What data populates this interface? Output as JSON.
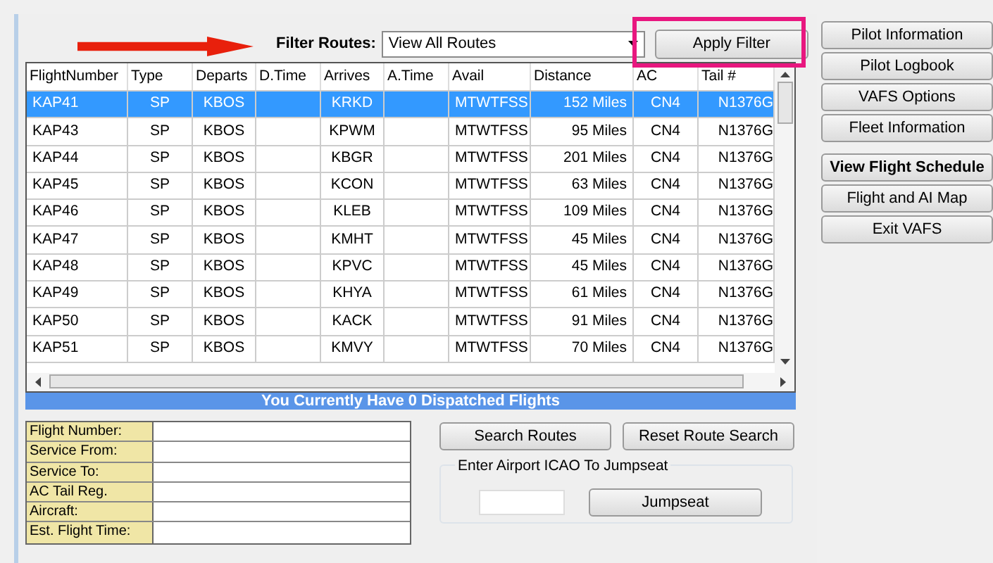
{
  "filter": {
    "label": "Filter Routes:",
    "value": "View All Routes",
    "apply": "Apply Filter"
  },
  "table": {
    "columns": [
      "FlightNumber",
      "Type",
      "Departs",
      "D.Time",
      "Arrives",
      "A.Time",
      "Avail",
      "Distance",
      "AC",
      "Tail #"
    ],
    "rows": [
      {
        "selected": true,
        "cells": [
          "KAP41",
          "SP",
          "KBOS",
          "",
          "KRKD",
          "",
          "MTWTFSS",
          "152 Miles",
          "CN4",
          "N1376G"
        ]
      },
      {
        "selected": false,
        "cells": [
          "KAP43",
          "SP",
          "KBOS",
          "",
          "KPWM",
          "",
          "MTWTFSS",
          "95 Miles",
          "CN4",
          "N1376G"
        ]
      },
      {
        "selected": false,
        "cells": [
          "KAP44",
          "SP",
          "KBOS",
          "",
          "KBGR",
          "",
          "MTWTFSS",
          "201 Miles",
          "CN4",
          "N1376G"
        ]
      },
      {
        "selected": false,
        "cells": [
          "KAP45",
          "SP",
          "KBOS",
          "",
          "KCON",
          "",
          "MTWTFSS",
          "63 Miles",
          "CN4",
          "N1376G"
        ]
      },
      {
        "selected": false,
        "cells": [
          "KAP46",
          "SP",
          "KBOS",
          "",
          "KLEB",
          "",
          "MTWTFSS",
          "109 Miles",
          "CN4",
          "N1376G"
        ]
      },
      {
        "selected": false,
        "cells": [
          "KAP47",
          "SP",
          "KBOS",
          "",
          "KMHT",
          "",
          "MTWTFSS",
          "45 Miles",
          "CN4",
          "N1376G"
        ]
      },
      {
        "selected": false,
        "cells": [
          "KAP48",
          "SP",
          "KBOS",
          "",
          "KPVC",
          "",
          "MTWTFSS",
          "45 Miles",
          "CN4",
          "N1376G"
        ]
      },
      {
        "selected": false,
        "cells": [
          "KAP49",
          "SP",
          "KBOS",
          "",
          "KHYA",
          "",
          "MTWTFSS",
          "61 Miles",
          "CN4",
          "N1376G"
        ]
      },
      {
        "selected": false,
        "cells": [
          "KAP50",
          "SP",
          "KBOS",
          "",
          "KACK",
          "",
          "MTWTFSS",
          "91 Miles",
          "CN4",
          "N1376G"
        ]
      },
      {
        "selected": false,
        "cells": [
          "KAP51",
          "SP",
          "KBOS",
          "",
          "KMVY",
          "",
          "MTWTFSS",
          "70 Miles",
          "CN4",
          "N1376G"
        ]
      }
    ]
  },
  "status": "You Currently Have 0 Dispatched Flights",
  "details": [
    "Flight Number:",
    "Service From:",
    "Service To:",
    "AC Tail Reg.",
    "Aircraft:",
    "Est. Flight Time:"
  ],
  "search_buttons": [
    "Search Routes",
    "Reset Route Search"
  ],
  "jumpseat": {
    "legend": "Enter Airport ICAO To Jumpseat",
    "button": "Jumpseat"
  },
  "side_buttons": [
    {
      "label": "Pilot Information",
      "bold": false
    },
    {
      "label": "Pilot Logbook",
      "bold": false
    },
    {
      "label": "VAFS Options",
      "bold": false
    },
    {
      "label": "Fleet Information",
      "bold": false
    },
    {
      "label": "View Flight Schedule",
      "bold": true
    },
    {
      "label": "Flight and AI Map",
      "bold": false
    },
    {
      "label": "Exit VAFS",
      "bold": false
    }
  ]
}
